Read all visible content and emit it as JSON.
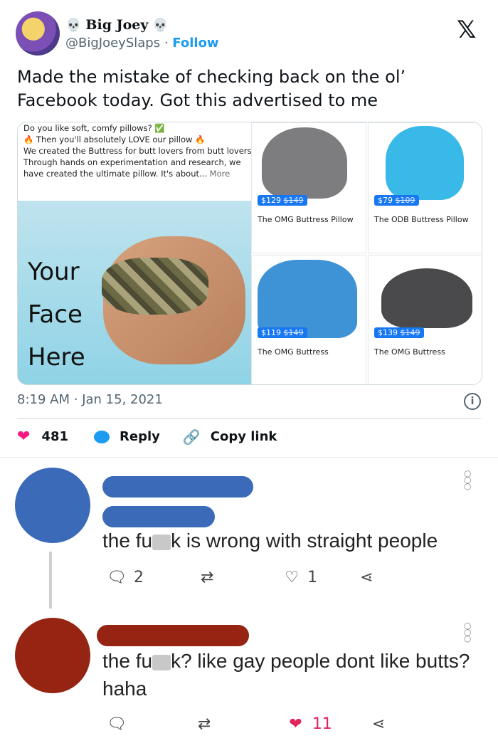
{
  "header": {
    "display_name": "Big Joey",
    "handle": "@BigJoeySlaps",
    "separator": "·",
    "follow_label": "Follow",
    "x_logo": "𝕏"
  },
  "tweet": {
    "text": "Made the mistake of checking back on the ol’ Facebook today. Got this advertised to me"
  },
  "ad": {
    "line1": "Do you like soft, comfy pillows? ✅",
    "line2": "🔥 Then you'll absolutely LOVE our pillow 🔥",
    "line3": "We created the Buttress for butt lovers from butt lovers. Through hands on experimentation and research, we have created the ultimate pillow. It's about...",
    "more": "More",
    "photo_lines": [
      "Your",
      "Face",
      "Here"
    ],
    "products": [
      {
        "price": "$129",
        "old": "$149",
        "name": "The OMG Buttress Pillow",
        "color": "#7d7d7f"
      },
      {
        "price": "$79",
        "old": "$109",
        "name": "The ODB Buttress Pillow",
        "color": "#39b9e8"
      },
      {
        "price": "$119",
        "old": "$149",
        "name": "The OMG Buttress",
        "color": "#3d93d6"
      },
      {
        "price": "$139",
        "old": "$149",
        "name": "The OMG Buttress",
        "color": "#4a4a4c"
      }
    ]
  },
  "meta": {
    "time": "8:19 AM",
    "sep": "·",
    "date": "Jan 15, 2021",
    "info": "i"
  },
  "actions": {
    "likes": "481",
    "reply_label": "Reply",
    "copy_label": "Copy link"
  },
  "comments": [
    {
      "text_before": "the fu",
      "text_after": "k is wrong with straight people",
      "replies": "2",
      "likes": "1",
      "avatar_color": "#3a6ab8"
    },
    {
      "text_before": "the fu",
      "text_after": "k? like gay people dont like butts? haha",
      "likes": "11",
      "avatar_color": "#952413"
    }
  ],
  "colors": {
    "accent": "#1d9bf0",
    "like": "#f91880",
    "fb_blue": "#1877f2"
  }
}
